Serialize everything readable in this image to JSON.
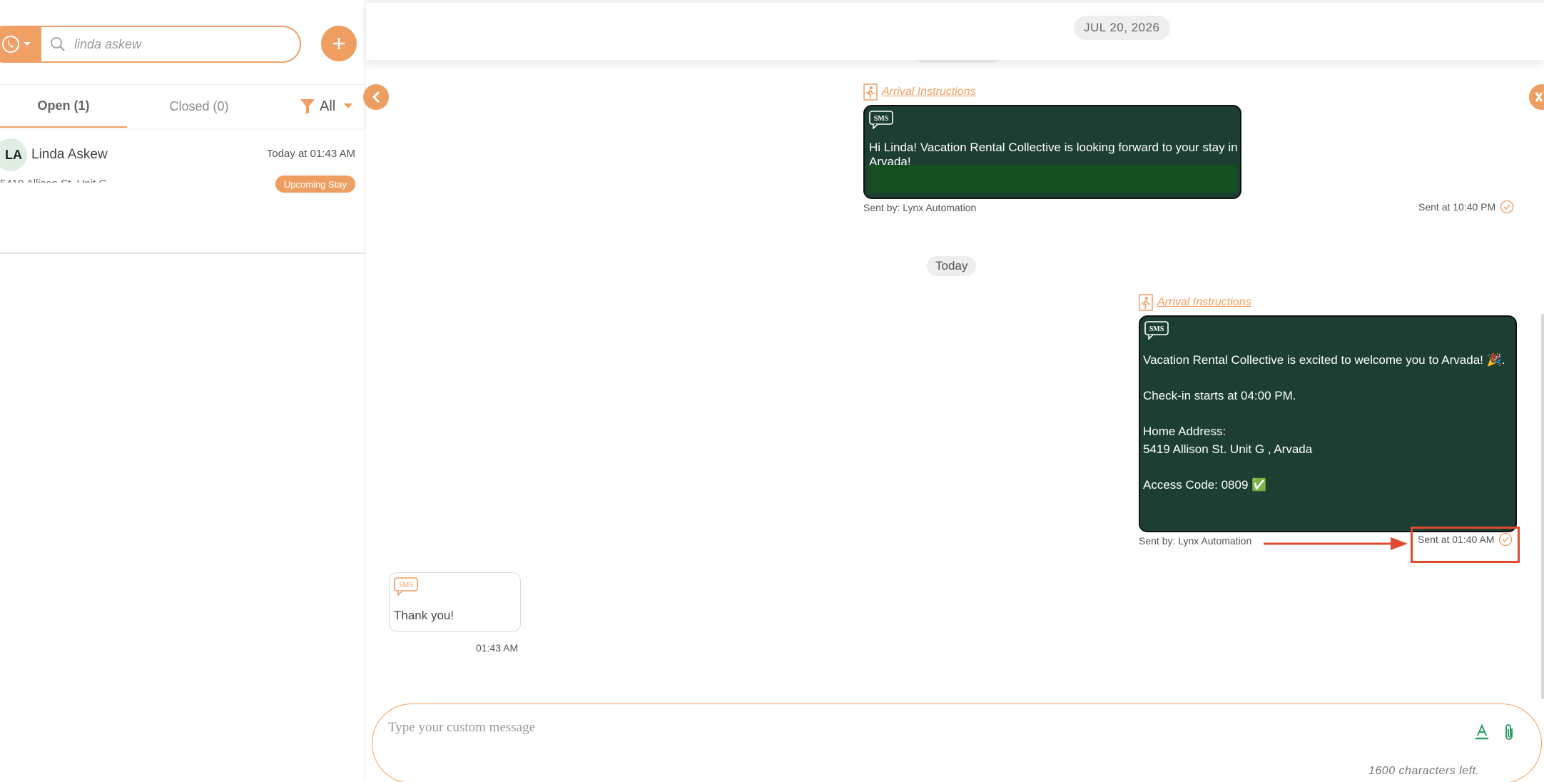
{
  "search": {
    "value": "linda askew"
  },
  "tabs": [
    {
      "label": "Open (1)"
    },
    {
      "label": "Closed (0)"
    }
  ],
  "filter": {
    "label": "All"
  },
  "conversation": {
    "initials": "LA",
    "name": "Linda Askew",
    "time": "Today at 01:43 AM",
    "badge": "Upcoming Stay"
  },
  "chat": {
    "top_date": "JUL 20, 2026",
    "today_label": "Today",
    "messages": [
      {
        "channel": "SMS",
        "tag": "Arrival Instructions",
        "lines": [
          "Hi Linda! Vacation Rental Collective is looking forward to your stay in Arvada!"
        ],
        "sent_by": "Sent by: Lynx Automation",
        "sent_at": "Sent at 10:40 PM"
      },
      {
        "channel": "SMS",
        "tag": "Arrival Instructions",
        "lines": [
          "Vacation Rental Collective is excited to welcome you to Arvada! 🎉.",
          "",
          "Check-in starts at 04:00 PM.",
          "",
          "Home Address:",
          "5419 Allison St. Unit G , Arvada",
          "",
          "Access Code: 0809 ✅"
        ],
        "sent_by": "Sent by: Lynx Automation",
        "sent_at": "Sent at 01:40 AM"
      },
      {
        "channel": "SMS",
        "text": "Thank you!",
        "time": "01:43 AM"
      }
    ]
  },
  "composer": {
    "placeholder": "Type your custom message",
    "char_count": "1600 characters left."
  },
  "colors": {
    "accent": "#ef9e62",
    "bubble_dark": "#1d3e33",
    "highlight": "#e24a2f"
  },
  "icons": [
    "phone-icon",
    "search-icon",
    "plus-icon",
    "filter-icon",
    "sms-icon",
    "check-circle-icon",
    "font-color-icon",
    "paperclip-icon",
    "person-walking-icon"
  ]
}
